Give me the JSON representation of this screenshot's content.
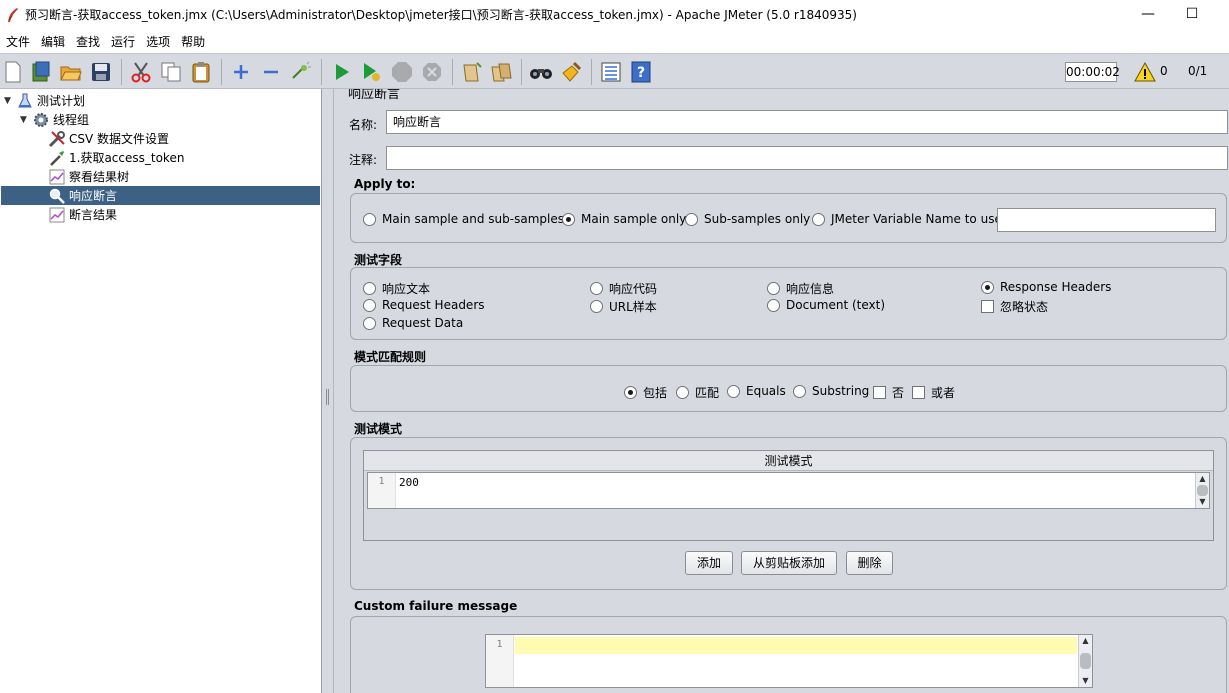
{
  "window": {
    "title": "预习断言-获取access_token.jmx (C:\\Users\\Administrator\\Desktop\\jmeter接口\\预习断言-获取access_token.jmx) - Apache JMeter (5.0 r1840935)",
    "minimize": "—",
    "maximize": "☐"
  },
  "menu": [
    "文件",
    "编辑",
    "查找",
    "运行",
    "选项",
    "帮助"
  ],
  "toolbar": {
    "timer": "00:00:02",
    "warnings": "0",
    "threads": "0/1"
  },
  "tree": [
    {
      "label": "测试计划",
      "icon": "test-plan-icon",
      "expanded": true
    },
    {
      "label": "线程组",
      "icon": "gear-icon",
      "expanded": true
    },
    {
      "label": "CSV 数据文件设置",
      "icon": "wrench-icon"
    },
    {
      "label": "1.获取access_token",
      "icon": "pipette-icon"
    },
    {
      "label": "察看结果树",
      "icon": "chart-icon"
    },
    {
      "label": "响应断言",
      "icon": "magnifier-icon",
      "selected": true
    },
    {
      "label": "断言结果",
      "icon": "chart-icon"
    }
  ],
  "panel": {
    "header": "响应断言",
    "name_label": "名称:",
    "name_value": "响应断言",
    "comment_label": "注释:",
    "comment_value": "",
    "apply_to": {
      "title": "Apply to:",
      "options": [
        "Main sample and sub-samples",
        "Main sample only",
        "Sub-samples only",
        "JMeter Variable Name to use"
      ],
      "selected": 1,
      "variable_value": ""
    },
    "field_to_test": {
      "title": "测试字段",
      "options": [
        "响应文本",
        "响应代码",
        "响应信息",
        "Response Headers",
        "Request Headers",
        "URL样本",
        "Document (text)",
        "Request Data"
      ],
      "selected": 3,
      "ignore_status": "忽略状态"
    },
    "pattern_rules": {
      "title": "模式匹配规则",
      "radios": [
        "包括",
        "匹配",
        "Equals",
        "Substring"
      ],
      "selected": 0,
      "checks": [
        "否",
        "或者"
      ]
    },
    "patterns": {
      "title": "测试模式",
      "column": "测试模式",
      "line_number": "1",
      "value": "200",
      "add": "添加",
      "add_clipboard": "从剪贴板添加",
      "delete": "删除"
    },
    "failure": {
      "title": "Custom failure message",
      "line_number": "1",
      "value": ""
    }
  },
  "colors": {
    "selection": "#3d6185",
    "panel": "#d6d9df",
    "editor_highlight": "#fffbb0"
  }
}
